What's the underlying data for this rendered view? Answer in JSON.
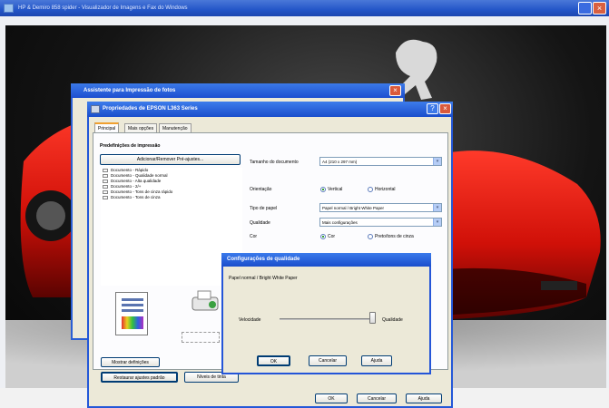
{
  "viewer": {
    "title": "HP & Demiro 858 spider - Visualizador de Imagens e Fax do Windows",
    "close_glyph": "×"
  },
  "assistant": {
    "title": "Assistente para Impressão de fotos",
    "close_glyph": "×"
  },
  "props": {
    "title": "Propriedades de EPSON L363 Series",
    "help_glyph": "?",
    "close_glyph": "×",
    "tabs": [
      "Principal",
      "Mais opções",
      "Manutenção"
    ],
    "section_title": "Predefinições de impressão",
    "add_remove_label": "Adicionar/Remover Pré-ajustes...",
    "presets": [
      "Documento - Rápido",
      "Documento - Qualidade normal",
      "Documento - Alta qualidade",
      "Documento - 2/+",
      "Documento - Tons de cinza rápido",
      "Documento - Tons de cinza"
    ],
    "doc_size_label": "Tamanho do documento",
    "doc_size_value": "A4 (210 x 297 mm)",
    "orientation_label": "Orientação",
    "orientation_vertical": "Vertical",
    "orientation_horizontal": "Horizontal",
    "paper_type_label": "Tipo de papel",
    "paper_type_value": "Papel normal / Bright White Paper",
    "quality_label": "Qualidade",
    "quality_value": "Mais configurações",
    "color_label": "Cor",
    "color_option": "Cor",
    "grayscale_option": "Preto/tons de cinza",
    "show_settings_label": "Mostrar definições",
    "restore_defaults_label": "Restaurar ajustes padrão",
    "ink_levels_label": "Níveis de tinta",
    "ok_label": "OK",
    "cancel_label": "Cancelar",
    "help_label": "Ajuda"
  },
  "quality_dialog": {
    "title": "Configurações de qualidade",
    "paper_text": "Papel normal / Bright White Paper",
    "speed_label": "Velocidade",
    "quality_label": "Qualidade",
    "slider_level": 1.0,
    "ok_label": "OK",
    "cancel_label": "Cancelar",
    "help_label": "Ajuda"
  },
  "colors": {
    "xp_title_blue": "#2458d8",
    "dialog_face": "#ece9d8",
    "car_red": "#e01810"
  }
}
